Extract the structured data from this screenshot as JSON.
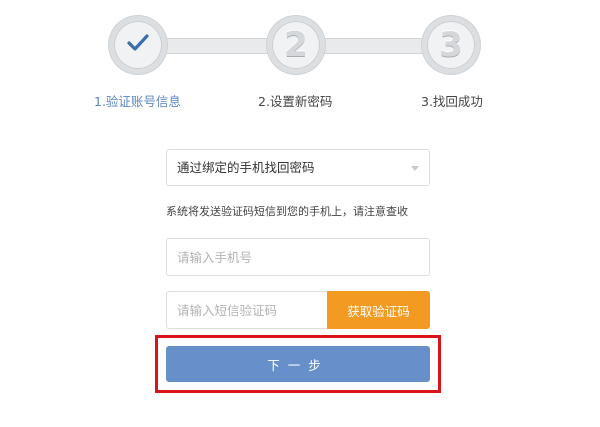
{
  "steps": [
    {
      "number": "",
      "label": "1.验证账号信息",
      "state": "completed",
      "icon": "checkmark-icon"
    },
    {
      "number": "2",
      "label": "2.设置新密码",
      "state": "pending"
    },
    {
      "number": "3",
      "label": "3.找回成功",
      "state": "pending"
    }
  ],
  "form": {
    "method_select": {
      "value": "通过绑定的手机找回密码",
      "icon": "chevron-down-icon"
    },
    "hint": "系统将发送验证码短信到您的手机上，请注意查收",
    "phone_placeholder": "请输入手机号",
    "code_placeholder": "请输入短信验证码",
    "get_code_label": "获取验证码",
    "next_label": "下一步"
  },
  "colors": {
    "accent": "#6790cb",
    "active_step_text": "#5b86c3",
    "get_code_button": "#f39a23",
    "highlight_box": "#d9141b"
  }
}
